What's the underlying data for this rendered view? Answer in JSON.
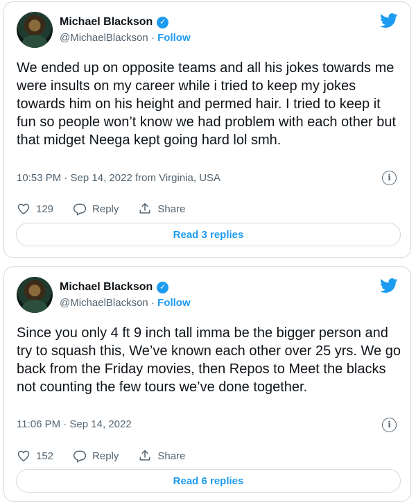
{
  "tweets": [
    {
      "author_name": "Michael Blackson",
      "handle": "@MichaelBlackson",
      "separator": "·",
      "follow_label": "Follow",
      "text": "We ended up on opposite teams and all his jokes towards me were insults on my career while i tried to keep my jokes towards him on his height and permed hair. I tried to keep it fun so people won’t know we had problem with each other but that midget Neega kept going hard lol smh.",
      "timestamp": "10:53 PM · Sep 14, 2022 from Virginia, USA",
      "likes": "129",
      "reply_label": "Reply",
      "share_label": "Share",
      "read_replies": "Read 3 replies"
    },
    {
      "author_name": "Michael Blackson",
      "handle": "@MichaelBlackson",
      "separator": "·",
      "follow_label": "Follow",
      "text": "Since you only 4 ft 9 inch tall imma be the bigger person and try to squash this, We’ve known each other over 25 yrs. We go back from the Friday movies, then Repos to Meet the blacks not counting the few tours we’ve done together.",
      "timestamp": "11:06 PM · Sep 14, 2022",
      "likes": "152",
      "reply_label": "Reply",
      "share_label": "Share",
      "read_replies": "Read 6 replies"
    }
  ],
  "colors": {
    "accent": "#1d9bf0",
    "muted": "#536471",
    "border": "#cfd9de",
    "text": "#0f1419"
  },
  "icons": {
    "verified": "verified-badge-icon",
    "logo": "twitter-bird-icon",
    "info": "info-icon",
    "like": "heart-icon",
    "reply": "reply-bubble-icon",
    "share": "share-icon"
  }
}
